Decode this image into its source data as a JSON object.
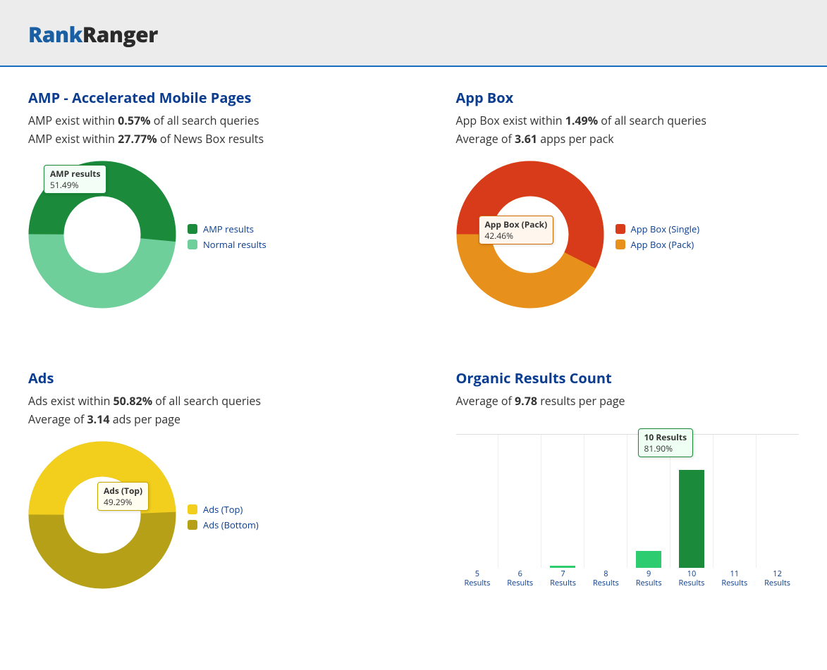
{
  "logo": {
    "part1": "Rank",
    "part2": "Ranger"
  },
  "panels": {
    "amp": {
      "title": "AMP - Accelerated Mobile Pages",
      "line1_pre": "AMP exist within ",
      "line1_val": "0.57%",
      "line1_post": " of all search queries",
      "line2_pre": "AMP exist within ",
      "line2_val": "27.77%",
      "line2_post": " of News Box results",
      "tooltip_label": "AMP results",
      "tooltip_value": "51.49%",
      "legend": [
        {
          "label": "AMP results",
          "color": "#1b8a3a"
        },
        {
          "label": "Normal results",
          "color": "#6fcf9b"
        }
      ]
    },
    "appbox": {
      "title": "App Box",
      "line1_pre": "App Box exist within ",
      "line1_val": "1.49%",
      "line1_post": " of all search queries",
      "line2_pre": "Average of ",
      "line2_val": "3.61",
      "line2_post": " apps per pack",
      "tooltip_label": "App Box (Pack)",
      "tooltip_value": "42.46%",
      "legend": [
        {
          "label": "App Box (Single)",
          "color": "#d73b1a"
        },
        {
          "label": "App Box (Pack)",
          "color": "#e8901c"
        }
      ]
    },
    "ads": {
      "title": "Ads",
      "line1_pre": "Ads exist within ",
      "line1_val": "50.82%",
      "line1_post": " of all search queries",
      "line2_pre": "Average of ",
      "line2_val": "3.14",
      "line2_post": " ads per page",
      "tooltip_label": "Ads (Top)",
      "tooltip_value": "49.29%",
      "legend": [
        {
          "label": "Ads (Top)",
          "color": "#f2cf1d"
        },
        {
          "label": "Ads (Bottom)",
          "color": "#b5a018"
        }
      ]
    },
    "organic": {
      "title": "Organic Results Count",
      "line1_pre": "Average of ",
      "line1_val": "9.78",
      "line1_post": " results per page",
      "tooltip_label": "10 Results",
      "tooltip_value": "81.90%",
      "bar_categories": [
        "5",
        "6",
        "7",
        "8",
        "9",
        "10",
        "11",
        "12"
      ],
      "bar_xlabel": "Results"
    }
  },
  "chart_data": [
    {
      "type": "pie",
      "title": "AMP - Accelerated Mobile Pages",
      "series": [
        {
          "name": "AMP results",
          "value": 51.49,
          "color": "#1b8a3a"
        },
        {
          "name": "Normal results",
          "value": 48.51,
          "color": "#6fcf9b"
        }
      ],
      "annotations": [
        "AMP results 51.49%"
      ]
    },
    {
      "type": "pie",
      "title": "App Box",
      "series": [
        {
          "name": "App Box (Single)",
          "value": 57.54,
          "color": "#d73b1a"
        },
        {
          "name": "App Box (Pack)",
          "value": 42.46,
          "color": "#e8901c"
        }
      ],
      "annotations": [
        "App Box (Pack) 42.46%"
      ]
    },
    {
      "type": "pie",
      "title": "Ads",
      "series": [
        {
          "name": "Ads (Top)",
          "value": 49.29,
          "color": "#f2cf1d"
        },
        {
          "name": "Ads (Bottom)",
          "value": 50.71,
          "color": "#b5a018"
        }
      ],
      "annotations": [
        "Ads (Top) 49.29%"
      ]
    },
    {
      "type": "bar",
      "title": "Organic Results Count",
      "xlabel": "Results",
      "ylabel": "%",
      "ylim": [
        0,
        100
      ],
      "categories": [
        "5",
        "6",
        "7",
        "8",
        "9",
        "10",
        "11",
        "12"
      ],
      "values": [
        0,
        0,
        2,
        0,
        14,
        81.9,
        0,
        0
      ],
      "annotations": [
        "10 Results 81.90%"
      ]
    }
  ]
}
